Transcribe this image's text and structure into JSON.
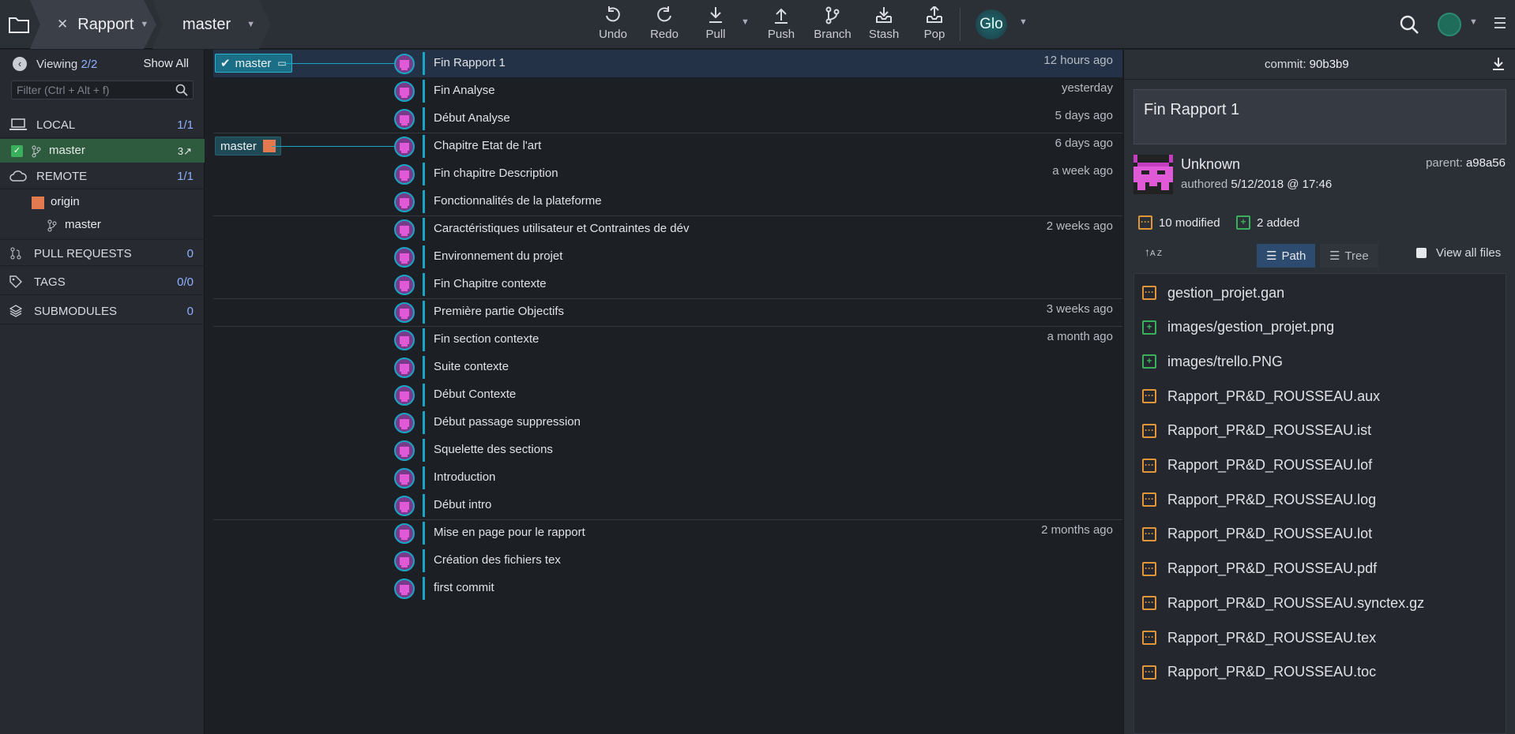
{
  "topbar": {
    "repo_name": "Rapport",
    "branch_name": "master",
    "tools": [
      {
        "label": "Undo",
        "icon": "undo-icon"
      },
      {
        "label": "Redo",
        "icon": "redo-icon"
      },
      {
        "label": "Pull",
        "icon": "pull-icon"
      },
      {
        "label": "Push",
        "icon": "push-icon"
      },
      {
        "label": "Branch",
        "icon": "branch-icon"
      },
      {
        "label": "Stash",
        "icon": "stash-icon"
      },
      {
        "label": "Pop",
        "icon": "pop-icon"
      }
    ],
    "glo_label": "Glo"
  },
  "left": {
    "viewing_label": "Viewing",
    "viewing_count": "2/2",
    "show_all": "Show All",
    "filter_placeholder": "Filter (Ctrl + Alt + f)",
    "local": {
      "label": "LOCAL",
      "count": "1/1"
    },
    "local_branch": {
      "label": "master",
      "ahead": "3↗"
    },
    "remote": {
      "label": "REMOTE",
      "count": "1/1"
    },
    "remote_origin": "origin",
    "remote_branch": "master",
    "pull_requests": {
      "label": "PULL REQUESTS",
      "count": "0"
    },
    "tags": {
      "label": "TAGS",
      "count": "0/0"
    },
    "submodules": {
      "label": "SUBMODULES",
      "count": "0"
    }
  },
  "graph": {
    "local_tag": "master",
    "remote_tag": "master",
    "commits": [
      {
        "msg": "Fin Rapport 1",
        "time": "12 hours ago"
      },
      {
        "msg": "Fin Analyse",
        "time": "yesterday"
      },
      {
        "msg": "Début Analyse",
        "time": "5 days ago"
      },
      {
        "msg": "Chapitre Etat de l'art",
        "time": "6 days ago"
      },
      {
        "msg": "Fin chapitre Description",
        "time": "a week ago"
      },
      {
        "msg": "Fonctionnalités de la plateforme",
        "time": ""
      },
      {
        "msg": "Caractéristiques utilisateur et Contraintes de dév",
        "time": "2 weeks ago"
      },
      {
        "msg": "Environnement du projet",
        "time": ""
      },
      {
        "msg": "Fin Chapitre contexte",
        "time": ""
      },
      {
        "msg": "Première partie Objectifs",
        "time": "3 weeks ago"
      },
      {
        "msg": "Fin section contexte",
        "time": "a month ago"
      },
      {
        "msg": "Suite contexte",
        "time": ""
      },
      {
        "msg": "Début Contexte",
        "time": ""
      },
      {
        "msg": "Début passage suppression",
        "time": ""
      },
      {
        "msg": "Squelette des sections",
        "time": ""
      },
      {
        "msg": "Introduction",
        "time": ""
      },
      {
        "msg": "Début intro",
        "time": ""
      },
      {
        "msg": "Mise en page pour le rapport",
        "time": "2 months ago"
      },
      {
        "msg": "Création des fichiers tex",
        "time": ""
      },
      {
        "msg": "first commit",
        "time": ""
      }
    ]
  },
  "right": {
    "commit_label": "commit:",
    "commit_sha": "90b3b9",
    "summary": "Fin Rapport 1",
    "author": "Unknown",
    "authored_label": "authored",
    "authored_date": "5/12/2018 @ 17:46",
    "parent_label": "parent:",
    "parent_sha": "a98a56",
    "modified": "10 modified",
    "added": "2 added",
    "sort_label": "A Z",
    "path_label": "Path",
    "tree_label": "Tree",
    "view_all": "View all files",
    "files": [
      {
        "name": "gestion_projet.gan",
        "status": "modified"
      },
      {
        "name": "images/gestion_projet.png",
        "status": "added"
      },
      {
        "name": "images/trello.PNG",
        "status": "added"
      },
      {
        "name": "Rapport_PR&D_ROUSSEAU.aux",
        "status": "modified"
      },
      {
        "name": "Rapport_PR&D_ROUSSEAU.ist",
        "status": "modified"
      },
      {
        "name": "Rapport_PR&D_ROUSSEAU.lof",
        "status": "modified"
      },
      {
        "name": "Rapport_PR&D_ROUSSEAU.log",
        "status": "modified"
      },
      {
        "name": "Rapport_PR&D_ROUSSEAU.lot",
        "status": "modified"
      },
      {
        "name": "Rapport_PR&D_ROUSSEAU.pdf",
        "status": "modified"
      },
      {
        "name": "Rapport_PR&D_ROUSSEAU.synctex.gz",
        "status": "modified"
      },
      {
        "name": "Rapport_PR&D_ROUSSEAU.tex",
        "status": "modified"
      },
      {
        "name": "Rapport_PR&D_ROUSSEAU.toc",
        "status": "modified"
      }
    ]
  },
  "colors": {
    "accent": "#1aa5c4",
    "modified": "#e2963a",
    "added": "#3ab05c",
    "count_blue": "#8fb1ff"
  }
}
